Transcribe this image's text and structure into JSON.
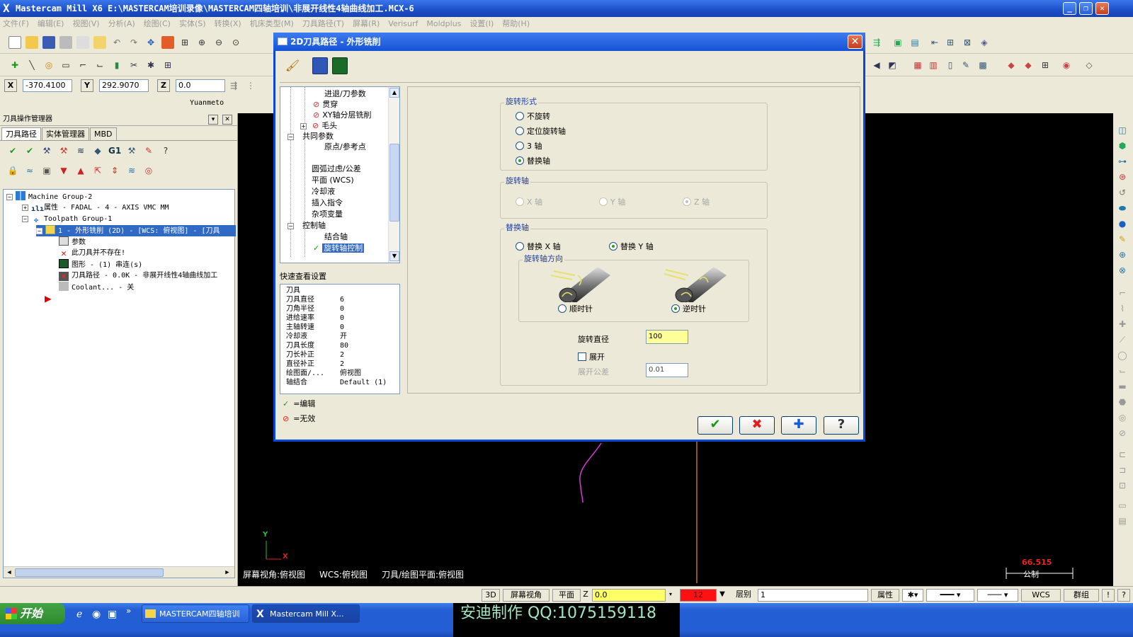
{
  "window": {
    "title": "Mastercam Mill X6  E:\\MASTERCAM培训录像\\MASTERCAM四轴培训\\非展开线性4轴曲线加工.MCX-6",
    "minimize": "_",
    "maximize": "❐",
    "close": "✕"
  },
  "menu": [
    "文件(F)",
    "编辑(E)",
    "视图(V)",
    "分析(A)",
    "绘图(C)",
    "实体(S)",
    "转换(X)",
    "机床类型(M)",
    "刀具路径(T)",
    "屏幕(R)",
    "Verisurf",
    "Moldplus",
    "设置(I)",
    "帮助(H)"
  ],
  "coords": {
    "x_label": "X",
    "x_value": "-370.4100",
    "y_label": "Y",
    "y_value": "292.9070",
    "z_label": "Z",
    "z_value": "0.0",
    "user": "Yuanmeto"
  },
  "left_panel": {
    "title": "刀具操作管理器",
    "tabs": [
      "刀具路径",
      "实体管理器",
      "MBD"
    ],
    "tree": [
      {
        "indent": 0,
        "text": "Machine Group-2",
        "icon": "machine-group-icon"
      },
      {
        "indent": 1,
        "text": "属性 - FADAL - 4 - AXIS VMC MM",
        "icon": "properties-icon"
      },
      {
        "indent": 1,
        "text": "Toolpath Group-1",
        "icon": "toolpath-group-icon"
      },
      {
        "indent": 2,
        "text": "1 - 外形铣削 (2D) - [WCS: 俯视图] - [刀具",
        "icon": "folder-icon",
        "selected": true
      },
      {
        "indent": 3,
        "text": "参数",
        "icon": "parameters-icon"
      },
      {
        "indent": 3,
        "text": "此刀具并不存在!",
        "icon": "invalid-tool-icon"
      },
      {
        "indent": 3,
        "text": "图形 - (1) 串连(s)",
        "icon": "geometry-icon"
      },
      {
        "indent": 3,
        "text": "刀具路径 - 0.0K - 非展开线性4轴曲线加工",
        "icon": "toolpath-dirty-icon"
      },
      {
        "indent": 3,
        "text": "Coolant... - 关",
        "icon": "coolant-icon"
      }
    ]
  },
  "graphics": {
    "status_left": "屏幕视角:俯视图",
    "status_mid": "WCS:俯视图",
    "status_right": "刀具/绘图平面:俯视图",
    "axis_y": "Y",
    "axis_x": "X",
    "scale_value": "66.515",
    "scale_unit": "公制"
  },
  "dialog": {
    "title": "2D刀具路径 - 外形铣削",
    "close": "✕",
    "param_tree": [
      {
        "indent": 2,
        "text": "进退/刀参数",
        "mark": ""
      },
      {
        "indent": 2,
        "text": "贯穿",
        "mark": "invalid"
      },
      {
        "indent": 2,
        "text": "XY轴分层铣削",
        "mark": "invalid"
      },
      {
        "indent": 2,
        "text": "毛头",
        "mark": "invalid",
        "expander": "+"
      },
      {
        "indent": 1,
        "text": "共同参数",
        "mark": "",
        "expander": "-"
      },
      {
        "indent": 2,
        "text": "原点/参考点",
        "mark": ""
      },
      {
        "indent": 1,
        "text": "",
        "mark": ""
      },
      {
        "indent": 1,
        "text": "圆弧过虑/公差",
        "mark": ""
      },
      {
        "indent": 1,
        "text": "平面 (WCS)",
        "mark": ""
      },
      {
        "indent": 1,
        "text": "冷却液",
        "mark": ""
      },
      {
        "indent": 1,
        "text": "插入指令",
        "mark": ""
      },
      {
        "indent": 1,
        "text": "杂项变量",
        "mark": ""
      },
      {
        "indent": 1,
        "text": "控制轴",
        "mark": "",
        "expander": "-"
      },
      {
        "indent": 2,
        "text": "结合轴",
        "mark": ""
      },
      {
        "indent": 2,
        "text": "旋转轴控制",
        "mark": "edited",
        "selected": true
      }
    ],
    "quick_view": {
      "title": "快速查看设置",
      "rows": [
        {
          "k": "刀具",
          "v": ""
        },
        {
          "k": "刀具直径",
          "v": "6"
        },
        {
          "k": "刀角半径",
          "v": "0"
        },
        {
          "k": "进给速率",
          "v": "0"
        },
        {
          "k": "主轴转速",
          "v": "0"
        },
        {
          "k": "冷却液",
          "v": "开"
        },
        {
          "k": "刀具长度",
          "v": "80"
        },
        {
          "k": "刀长补正",
          "v": "2"
        },
        {
          "k": "直径补正",
          "v": "2"
        },
        {
          "k": "绘图面/...",
          "v": "俯视图"
        },
        {
          "k": "轴结合",
          "v": "Default (1)"
        }
      ]
    },
    "legend": {
      "edited": "=编辑",
      "invalid": "=无效"
    },
    "rotation_type": {
      "label": "旋转形式",
      "options": [
        {
          "text": "不旋转",
          "on": false
        },
        {
          "text": "定位旋转轴",
          "on": false
        },
        {
          "text": "3 轴",
          "on": false
        },
        {
          "text": "替换轴",
          "on": true
        }
      ]
    },
    "rotary_axis": {
      "label": "旋转轴",
      "options": [
        {
          "text": "X 轴",
          "on": false
        },
        {
          "text": "Y 轴",
          "on": false
        },
        {
          "text": "Z 轴",
          "on": true
        }
      ]
    },
    "replace_axis": {
      "label": "替换轴",
      "options": [
        {
          "text": "替换 X 轴",
          "on": false
        },
        {
          "text": "替换 Y 轴",
          "on": true
        }
      ],
      "direction_label": "旋转轴方向",
      "cw": "顺时针",
      "ccw": "逆时针",
      "ccw_on": true
    },
    "rotation_diameter_label": "旋转直径",
    "rotation_diameter": "100",
    "unwrap_label": "展开",
    "unwrap_tol_label": "展开公差",
    "unwrap_tol": "0.01",
    "buttons": {
      "ok": "✔",
      "cancel": "✖",
      "add": "✚",
      "help": "?"
    }
  },
  "statusbar": {
    "view3d": "3D",
    "screen_view": "屏幕视角",
    "plane": "平面",
    "z_label": "Z",
    "z_value": "0.0",
    "color_value": "12",
    "layer_label": "层别",
    "layer_value": "1",
    "attr_label": "属性",
    "wcs": "WCS",
    "group": "群组",
    "info": "!",
    "help": "?"
  },
  "taskbar": {
    "start": "开始",
    "items": [
      "MASTERCAM四轴培训",
      "Mastercam Mill X..."
    ]
  },
  "watermark": {
    "text": "安迪制作    QQ:1075159118"
  },
  "colors": {
    "title_blue": "#1c4fc9",
    "selection": "#316ac5",
    "input_yellow": "#ffff99",
    "curve_magenta": "#d63bd6"
  }
}
